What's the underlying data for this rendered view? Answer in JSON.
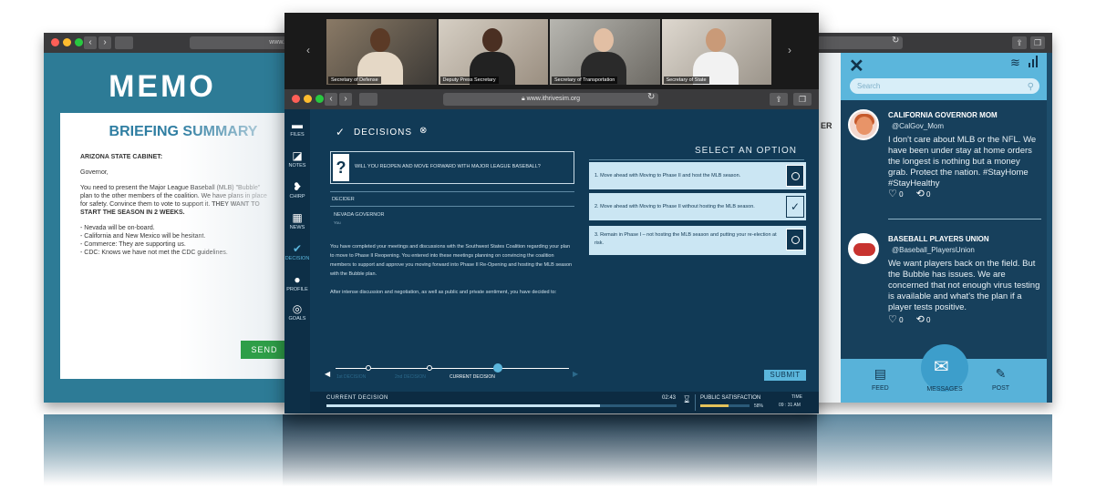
{
  "memo_window": {
    "url": "www.",
    "memo_title": "MEMO",
    "briefing_title": "BRIEFING SUMMARY",
    "recipient": "ARIZONA STATE CABINET:",
    "salutation": "Governor,",
    "body_normal": "You need to present the Major League Baseball (MLB) \"Bubble\" plan to the other members of the coalition. We have plans in place for safety. Convince them to vote to support it. ",
    "body_bold": "THEY WANT TO START THE SEASON IN 2 WEEKS.",
    "bullets": [
      "- Nevada will be on-board.",
      "- California and New Mexico will be hesitant.",
      "- Commerce: They are supporting us.",
      "- CDC: Knows we have not met the CDC guidelines."
    ],
    "send_label": "SEND"
  },
  "video_call": {
    "participants": [
      "Secretary of Defense",
      "Deputy Press Secretary",
      "Secretary of Transportation",
      "Secretary of State"
    ],
    "prev_icon": "chevron-left-icon",
    "next_icon": "chevron-right-icon"
  },
  "browser": {
    "url": "www.ithrivesim.org"
  },
  "sim": {
    "sidebar": [
      {
        "label": "FILES",
        "icon": "folder-icon"
      },
      {
        "label": "NOTES",
        "icon": "notes-icon"
      },
      {
        "label": "CHIRP",
        "icon": "bird-icon"
      },
      {
        "label": "NEWS",
        "icon": "newspaper-icon"
      },
      {
        "label": "DECISION",
        "icon": "check-icon"
      },
      {
        "label": "PROFILE",
        "icon": "person-icon"
      },
      {
        "label": "GOALS",
        "icon": "target-icon"
      }
    ],
    "section_title": "DECISIONS",
    "question": "WILL YOU REOPEN AND MOVE FORWARD WITH MAJOR LEAGUE BASEBALL?",
    "decider_label": "DECIDER",
    "decider_name": "NEVADA GOVERNOR",
    "decider_sub": "You",
    "narrative": [
      "You have completed your meetings and discussions with the Southwest States Coalition regarding your plan to move to Phase II Reopening. You entered into these meetings planning on convincing the coalition members to support and approve you moving forward into Phase II Re-Opening and hosting the MLB season with the Bubble plan.",
      "After intense discussion and negotiation, as well as public and private sentiment, you have decided to:"
    ],
    "select_heading": "SELECT AN OPTION",
    "options": [
      {
        "text": "1. Move ahead with Moving to Phase II and host the MLB season.",
        "selected": false
      },
      {
        "text": "2. Move ahead with Moving to Phase II without hosting the MLB season.",
        "selected": true
      },
      {
        "text": "3. Remain in Phase I – not hosting the MLB season and putting your re-election at risk.",
        "selected": false
      }
    ],
    "timeline": [
      "1st DECISION",
      "2nd DECISION",
      "CURRENT DECISION"
    ],
    "submit_label": "SUBMIT",
    "status": {
      "current_decision_label": "CURRENT DECISION",
      "countdown": "02:43",
      "countdown_progress": 0.78,
      "satisfaction_label": "PUBLIC SATISFACTION",
      "satisfaction_value": "58%",
      "satisfaction_progress": 0.58,
      "time_label": "TIME",
      "time_value": "09 : 31 AM"
    }
  },
  "chirp": {
    "search_placeholder": "Search",
    "behind_text": "ER",
    "posts": [
      {
        "name": "CALIFORNIA GOVERNOR MOM",
        "handle": "@CalGov_Mom",
        "text": "I don't care about MLB or the NFL. We have been under stay at home orders the longest is nothing but a money grab. Protect the nation. #StayHome #StayHealthy",
        "likes": "0",
        "rechirps": "0"
      },
      {
        "name": "BASEBALL PLAYERS UNION",
        "handle": "@Baseball_PlayersUnion",
        "text": "We want players back on the field. But the Bubble has issues. We are concerned that not enough virus testing is available and what's the plan if a player tests positive.",
        "likes": "0",
        "rechirps": "0"
      }
    ],
    "nav": [
      "FEED",
      "MESSAGES",
      "POST"
    ],
    "colors": {
      "header": "#5bb6dc",
      "panel": "#17405c"
    }
  }
}
